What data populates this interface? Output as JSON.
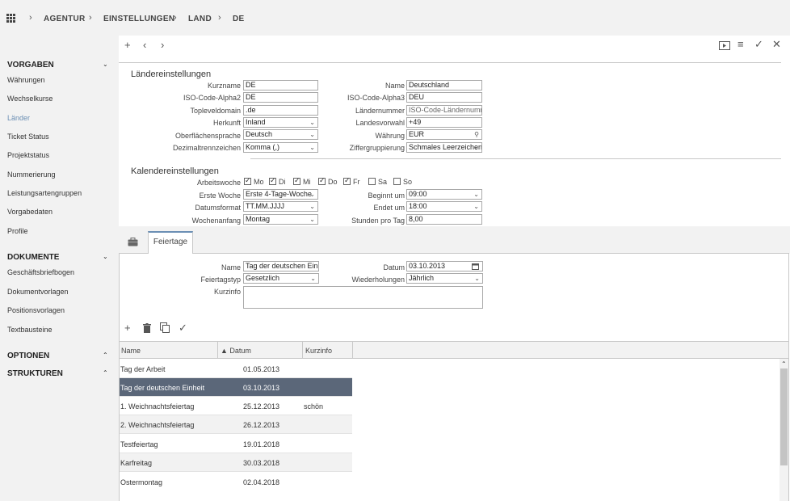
{
  "breadcrumb": {
    "items": [
      "AGENTUR",
      "EINSTELLUNGEN",
      "LAND",
      "DE"
    ]
  },
  "sidebar": {
    "sections": [
      {
        "title": "VORGABEN",
        "items": [
          "Währungen",
          "Wechselkurse",
          "Länder",
          "Ticket Status",
          "Projektstatus",
          "Nummerierung",
          "Leistungsartengruppen",
          "Vorgabedaten",
          "Profile"
        ]
      },
      {
        "title": "DOKUMENTE",
        "items": [
          "Geschäftsbriefbogen",
          "Dokumentvorlagen",
          "Positionsvorlagen",
          "Textbausteine"
        ]
      },
      {
        "title": "OPTIONEN",
        "items": []
      },
      {
        "title": "STRUKTUREN",
        "items": []
      }
    ],
    "active_item": "Länder"
  },
  "laendereinstellungen": {
    "title": "Ländereinstellungen",
    "left": [
      {
        "label": "Kurzname",
        "value": "DE"
      },
      {
        "label": "ISO-Code-Alpha2",
        "value": "DE"
      },
      {
        "label": "Topleveldomain",
        "value": ".de"
      },
      {
        "label": "Herkunft",
        "value": "Inland"
      },
      {
        "label": "Oberflächensprache",
        "value": "Deutsch"
      },
      {
        "label": "Dezimaltrennzeichen",
        "value": "Komma (,)"
      }
    ],
    "right": [
      {
        "label": "Name",
        "value": "Deutschland"
      },
      {
        "label": "ISO-Code-Alpha3",
        "value": "DEU"
      },
      {
        "label": "Ländernummer",
        "value": "ISO-Code-Ländernummer"
      },
      {
        "label": "Landesvorwahl",
        "value": "+49"
      },
      {
        "label": "Währung",
        "value": "EUR"
      },
      {
        "label": "Ziffergruppierung",
        "value": "Schmales Leerzeichen"
      }
    ]
  },
  "kalendereinstellungen": {
    "title": "Kalendereinstellungen",
    "arbeitswoche_label": "Arbeitswoche",
    "days": [
      {
        "label": "Mo",
        "checked": true
      },
      {
        "label": "Di",
        "checked": true
      },
      {
        "label": "Mi",
        "checked": true
      },
      {
        "label": "Do",
        "checked": true
      },
      {
        "label": "Fr",
        "checked": true
      },
      {
        "label": "Sa",
        "checked": false
      },
      {
        "label": "So",
        "checked": false
      }
    ],
    "left": [
      {
        "label": "Erste Woche",
        "value": "Erste 4-Tage-Woche"
      },
      {
        "label": "Datumsformat",
        "value": "TT.MM.JJJJ"
      },
      {
        "label": "Wochenanfang",
        "value": "Montag"
      }
    ],
    "right": [
      {
        "label": "Beginnt um",
        "value": "09:00"
      },
      {
        "label": "Endet um",
        "value": "18:00"
      },
      {
        "label": "Stunden pro Tag",
        "value": "8,00"
      }
    ]
  },
  "tab": {
    "label": "Feiertage"
  },
  "feiertag_form": {
    "name_label": "Name",
    "name_value": "Tag der deutschen Einheit",
    "typ_label": "Feiertagstyp",
    "typ_value": "Gesetzlich",
    "kurzinfo_label": "Kurzinfo",
    "kurzinfo_value": "",
    "datum_label": "Datum",
    "datum_value": "03.10.2013",
    "wdh_label": "Wiederholungen",
    "wdh_value": "Jährlich"
  },
  "grid": {
    "columns": [
      "Name",
      "▲ Datum",
      "Kurzinfo"
    ],
    "rows": [
      {
        "name": "Tag der Arbeit",
        "datum": "01.05.2013",
        "kurzinfo": ""
      },
      {
        "name": "Tag der deutschen Einheit",
        "datum": "03.10.2013",
        "kurzinfo": ""
      },
      {
        "name": "1. Weichnachtsfeiertag",
        "datum": "25.12.2013",
        "kurzinfo": "schön"
      },
      {
        "name": "2. Weichnachtsfeiertag",
        "datum": "26.12.2013",
        "kurzinfo": ""
      },
      {
        "name": "Testfeiertag",
        "datum": "19.01.2018",
        "kurzinfo": ""
      },
      {
        "name": "Karfreitag",
        "datum": "30.03.2018",
        "kurzinfo": ""
      },
      {
        "name": "Ostermontag",
        "datum": "02.04.2018",
        "kurzinfo": ""
      }
    ],
    "selected_index": 1
  },
  "icons": {
    "toolbar": [
      "plus-icon",
      "chevron-left-icon",
      "chevron-right-icon",
      "preview-icon",
      "menu-icon",
      "check-icon",
      "close-icon"
    ],
    "grid_toolbar": [
      "plus-icon",
      "trash-icon",
      "copy-icon",
      "check-icon"
    ]
  },
  "colors": {
    "accent": "#6b8fb4",
    "selected_row": "#5b6779",
    "panel_bg": "#f2f2f2"
  }
}
